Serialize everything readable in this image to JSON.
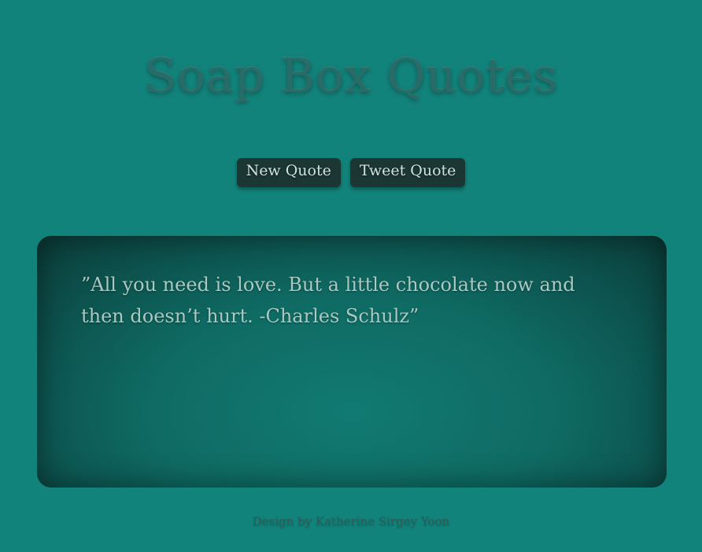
{
  "header": {
    "title": "Soap Box Quotes"
  },
  "actions": {
    "new_quote_label": "New Quote",
    "tweet_quote_label": "Tweet Quote"
  },
  "quote": {
    "text": "”All you need is love. But a little chocolate now and then doesn’t hurt. -Charles Schulz”"
  },
  "footer": {
    "credit": "Design by Katherine Sirgey Yoon"
  },
  "colors": {
    "background": "#12837b",
    "button": "#1b3633",
    "quote_box": "#0f6b64",
    "title": "#2a6b68"
  }
}
